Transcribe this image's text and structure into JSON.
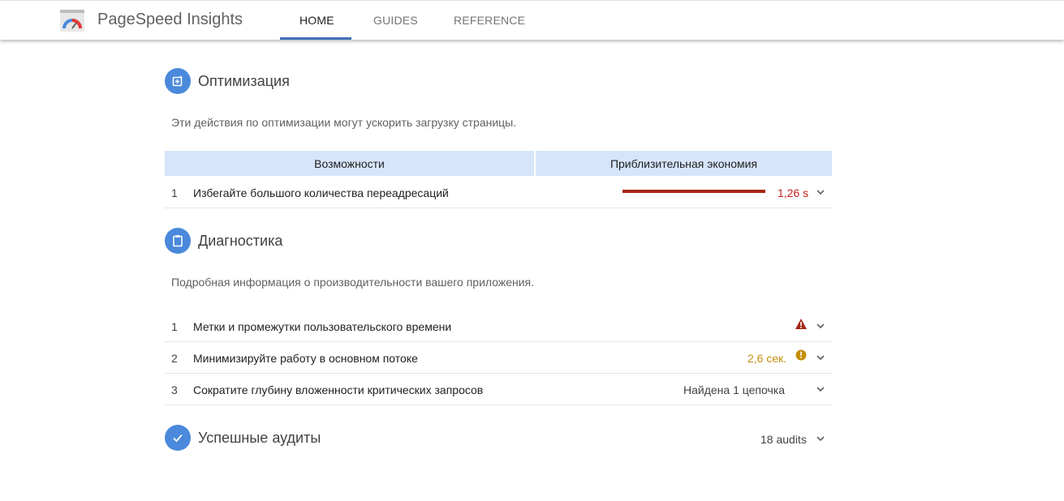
{
  "header": {
    "app_title": "PageSpeed Insights",
    "logo_icon": "pagespeed-gauge-icon",
    "tabs": [
      {
        "label": "HOME",
        "active": true
      },
      {
        "label": "GUIDES",
        "active": false
      },
      {
        "label": "REFERENCE",
        "active": false
      }
    ]
  },
  "optimization": {
    "icon": "optimization-icon",
    "title": "Оптимизация",
    "description": "Эти действия по оптимизации могут ускорить загрузку страницы.",
    "columns": [
      "Возможности",
      "Приблизительная экономия"
    ],
    "rows": [
      {
        "num": "1",
        "label": "Избегайте большого количества переадресаций",
        "value": "1,26 s",
        "color": "#c5221f"
      }
    ]
  },
  "diagnostics": {
    "icon": "clipboard-icon",
    "title": "Диагностика",
    "description": "Подробная информация о производительности вашего приложения.",
    "rows": [
      {
        "num": "1",
        "label": "Метки и промежутки пользовательского времени",
        "value": "",
        "status_icon": "warning-triangle-icon",
        "color": "#a52714"
      },
      {
        "num": "2",
        "label": "Минимизируйте работу в основном потоке",
        "value": "2,6 сек.",
        "status_icon": "info-circle-icon",
        "color": "#c48f0b"
      },
      {
        "num": "3",
        "label": "Сократите глубину вложенности критических запросов",
        "value": "Найдена 1 цепочка",
        "status_icon": "",
        "color": "#424242"
      }
    ]
  },
  "passed": {
    "icon": "check-icon",
    "title": "Успешные аудиты",
    "count_label": "18 audits"
  },
  "colors": {
    "accent": "#4a89dc",
    "table_header": "#d6e5fa",
    "fail": "#a52714",
    "average": "#c48f0b"
  }
}
